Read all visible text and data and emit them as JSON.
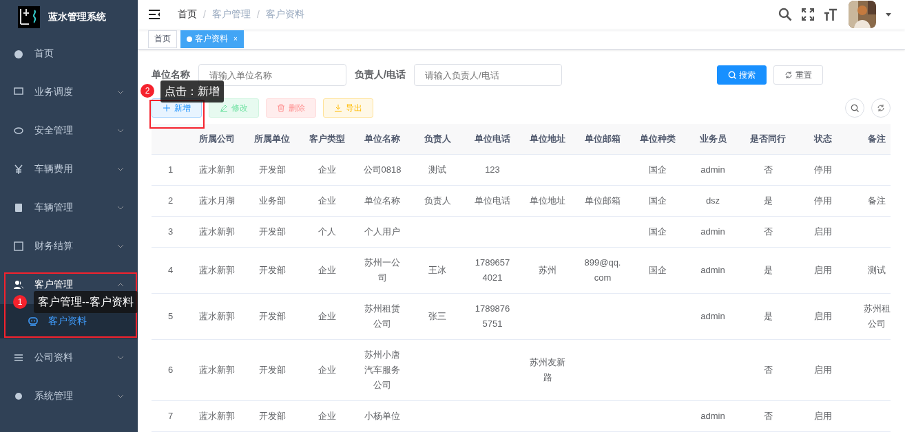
{
  "sidebar": {
    "title": "蓝水管理系统",
    "items": [
      {
        "label": "首页",
        "expandable": false,
        "expanded": false
      },
      {
        "label": "业务调度",
        "expandable": true,
        "expanded": false
      },
      {
        "label": "安全管理",
        "expandable": true,
        "expanded": false
      },
      {
        "label": "车辆费用",
        "expandable": true,
        "expanded": false
      },
      {
        "label": "车辆管理",
        "expandable": true,
        "expanded": false
      },
      {
        "label": "财务结算",
        "expandable": true,
        "expanded": false
      },
      {
        "label": "客户管理",
        "expandable": true,
        "expanded": true,
        "children": [
          {
            "label": "客户资料",
            "selected": true
          }
        ]
      },
      {
        "label": "公司资料",
        "expandable": true,
        "expanded": false
      },
      {
        "label": "系统管理",
        "expandable": true,
        "expanded": false
      }
    ]
  },
  "breadcrumb": {
    "separator": "/",
    "items": [
      "首页",
      "客户管理",
      "客户资料"
    ]
  },
  "tags": [
    {
      "label": "首页",
      "selected": false,
      "closable": false
    },
    {
      "label": "客户资料",
      "selected": true,
      "closable": true,
      "close": "×"
    }
  ],
  "search_form": {
    "fields": [
      {
        "label": "单位名称",
        "placeholder": "请输入单位名称"
      },
      {
        "label": "负责人/电话",
        "placeholder": "请输入负责人/电话"
      }
    ],
    "buttons": [
      {
        "label": "搜索",
        "kind": "primary"
      },
      {
        "label": "重置",
        "kind": "default"
      }
    ]
  },
  "toolbar": [
    {
      "label": "新增",
      "kind": "primary"
    },
    {
      "label": "修改",
      "kind": "success"
    },
    {
      "label": "删除",
      "kind": "danger"
    },
    {
      "label": "导出",
      "kind": "warning"
    }
  ],
  "table": {
    "columns": [
      "",
      "所属公司",
      "所属单位",
      "客户类型",
      "单位名称",
      "负责人",
      "单位电话",
      "单位地址",
      "单位邮箱",
      "单位种类",
      "业务员",
      "是否同行",
      "状态",
      "备注"
    ],
    "rows": [
      [
        "1",
        "蓝水新郭",
        "开发部",
        "企业",
        "公司0818",
        "测试",
        "123",
        null,
        null,
        "国企",
        "admin",
        "否",
        "停用",
        null
      ],
      [
        "2",
        "蓝水月湖",
        "业务部",
        "企业",
        "单位名称",
        "负责人",
        "单位电话",
        "单位地址",
        "单位邮箱",
        "国企",
        "dsz",
        "是",
        "停用",
        "备注"
      ],
      [
        "3",
        "蓝水新郭",
        "开发部",
        "个人",
        "个人用户",
        null,
        null,
        null,
        null,
        "国企",
        "admin",
        "否",
        "启用",
        null
      ],
      [
        "4",
        "蓝水新郭",
        "开发部",
        "企业",
        "苏州一公司",
        "王冰",
        "17896574021",
        "苏州",
        "899@qq.com",
        "国企",
        "admin",
        "是",
        "启用",
        "测试"
      ],
      [
        "5",
        "蓝水新郭",
        "开发部",
        "企业",
        "苏州租赁公司",
        "张三",
        "17898765751",
        null,
        null,
        null,
        "admin",
        "是",
        "启用",
        "苏州租公司"
      ],
      [
        "6",
        "蓝水新郭",
        "开发部",
        "企业",
        "苏州小唐汽车服务公司",
        null,
        null,
        "苏州友新路",
        null,
        null,
        null,
        "否",
        "启用",
        null
      ],
      [
        "7",
        "蓝水新郭",
        "开发部",
        "企业",
        "小杨单位",
        null,
        null,
        null,
        null,
        null,
        "admin",
        "否",
        "启用",
        null
      ]
    ]
  },
  "annotations": [
    {
      "number": "1",
      "text": "客户管理--客户资料"
    },
    {
      "number": "2",
      "text": "点击：新增"
    }
  ]
}
